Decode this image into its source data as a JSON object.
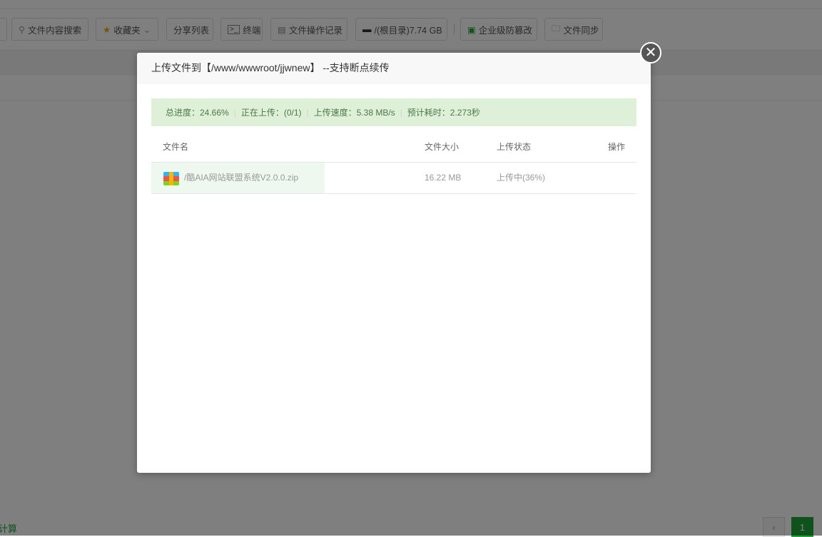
{
  "toolbar": {
    "items": [
      {
        "label": "文件内容搜索",
        "icon": "search-icon"
      },
      {
        "label": "收藏夹",
        "icon": "star-icon"
      },
      {
        "label": "分享列表"
      },
      {
        "label": "终端",
        "icon": "terminal-icon"
      },
      {
        "label": "文件操作记录",
        "icon": "log-icon"
      },
      {
        "label": "/(根目录)7.74 GB",
        "icon": "disk-icon"
      },
      {
        "label": "企业级防篡改",
        "icon": "shield-file-icon"
      },
      {
        "label": "文件同步",
        "icon": "folder-sync-icon"
      }
    ]
  },
  "footer": {
    "calc_label": "计算",
    "page_prev": "‹",
    "page_current": "1"
  },
  "modal": {
    "title": "上传文件到【/www/wwwroot/jjwnew】 --支持断点续传",
    "close": "✕",
    "progress": {
      "total": "总进度：24.66%",
      "uploading": "正在上传：(0/1)",
      "speed": "上传速度：5.38 MB/s",
      "eta": "预计耗时：2.273秒"
    },
    "columns": {
      "name": "文件名",
      "size": "文件大小",
      "status": "上传状态",
      "actions": "操作"
    },
    "files": [
      {
        "name": "/酷AIA网站联盟系统V2.0.0.zip",
        "size": "16.22 MB",
        "status": "上传中(36%)"
      }
    ]
  }
}
